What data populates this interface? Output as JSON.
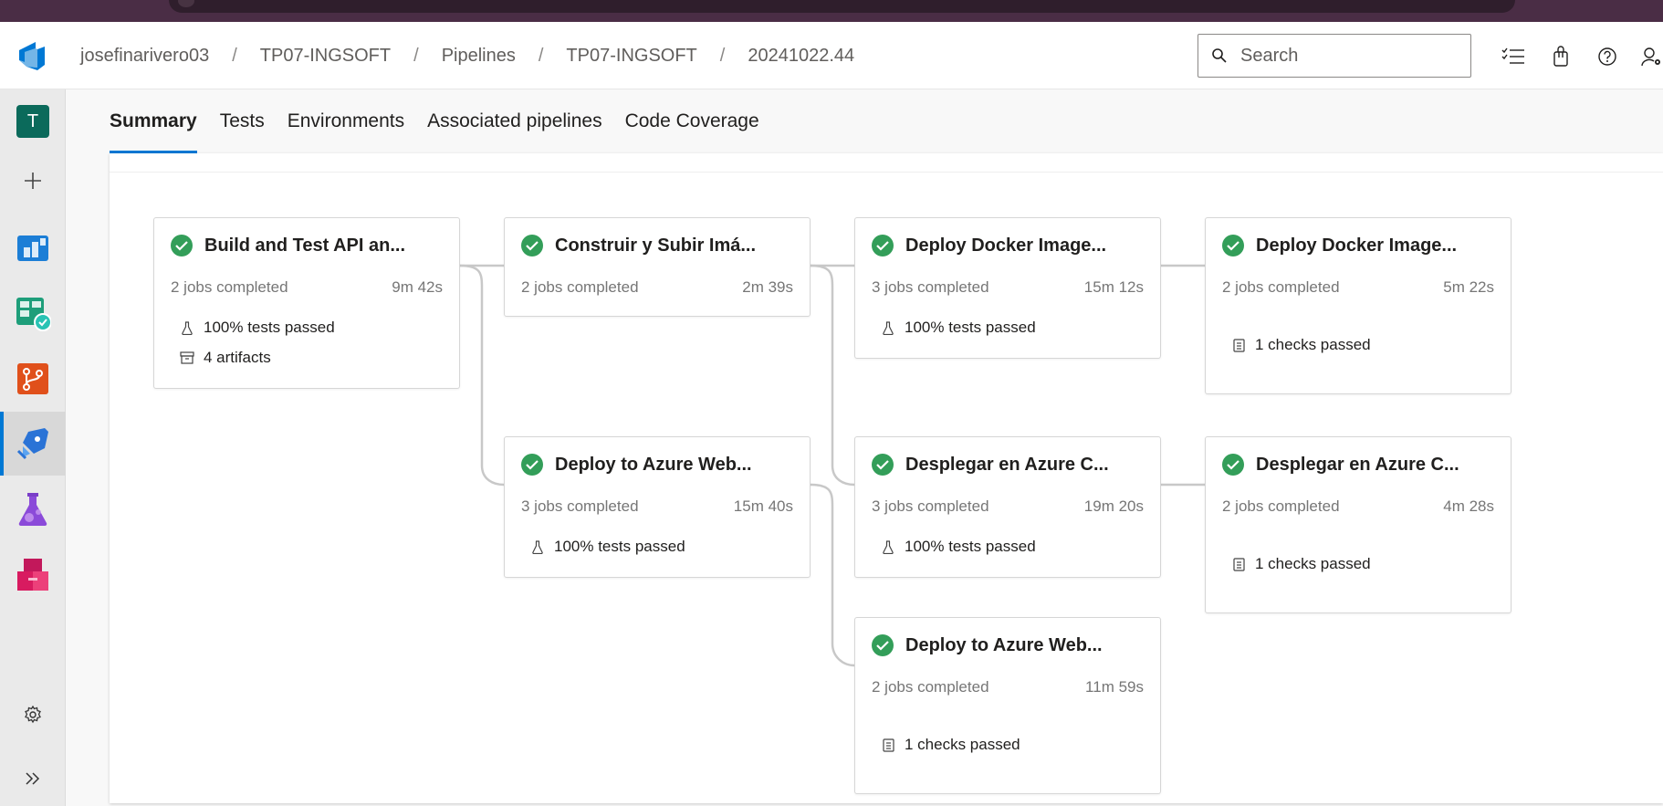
{
  "breadcrumb": [
    "josefinarivero03",
    "TP07-INGSOFT",
    "Pipelines",
    "TP07-INGSOFT",
    "20241022.44"
  ],
  "breadcrumb_separator": "/",
  "search": {
    "placeholder": "Search"
  },
  "header_icons": [
    "task-list-icon",
    "shopping-bag-icon",
    "help-icon",
    "user-settings-icon"
  ],
  "project_badge": "T",
  "leftnav": [
    "add-icon",
    "boards-icon",
    "test-check-icon",
    "repos-icon",
    "pipelines-icon",
    "test-plans-icon",
    "artifacts-icon"
  ],
  "tabs": [
    "Summary",
    "Tests",
    "Environments",
    "Associated pipelines",
    "Code Coverage"
  ],
  "active_tab": "Summary",
  "stages": [
    {
      "name": "Build and Test API an...",
      "jobs": "2 jobs completed",
      "duration": "9m 42s",
      "tests": "100% tests passed",
      "artifacts": "4 artifacts"
    },
    {
      "name": "Construir y Subir Imá...",
      "jobs": "2 jobs completed",
      "duration": "2m 39s"
    },
    {
      "name": "Deploy Docker Image...",
      "jobs": "3 jobs completed",
      "duration": "15m 12s",
      "tests": "100% tests passed"
    },
    {
      "name": "Deploy Docker Image...",
      "jobs": "2 jobs completed",
      "duration": "5m 22s",
      "checks": "1 checks passed"
    },
    {
      "name": "Deploy to Azure Web...",
      "jobs": "3 jobs completed",
      "duration": "15m 40s",
      "tests": "100% tests passed"
    },
    {
      "name": "Desplegar en Azure C...",
      "jobs": "3 jobs completed",
      "duration": "19m 20s",
      "tests": "100% tests passed"
    },
    {
      "name": "Desplegar en Azure C...",
      "jobs": "2 jobs completed",
      "duration": "4m 28s",
      "checks": "1 checks passed"
    },
    {
      "name": "Deploy to Azure Web...",
      "jobs": "2 jobs completed",
      "duration": "11m 59s",
      "checks": "1 checks passed"
    }
  ],
  "colors": {
    "accent": "#0078d4",
    "success": "#339e59",
    "nav_bg": "#eaeaea"
  }
}
